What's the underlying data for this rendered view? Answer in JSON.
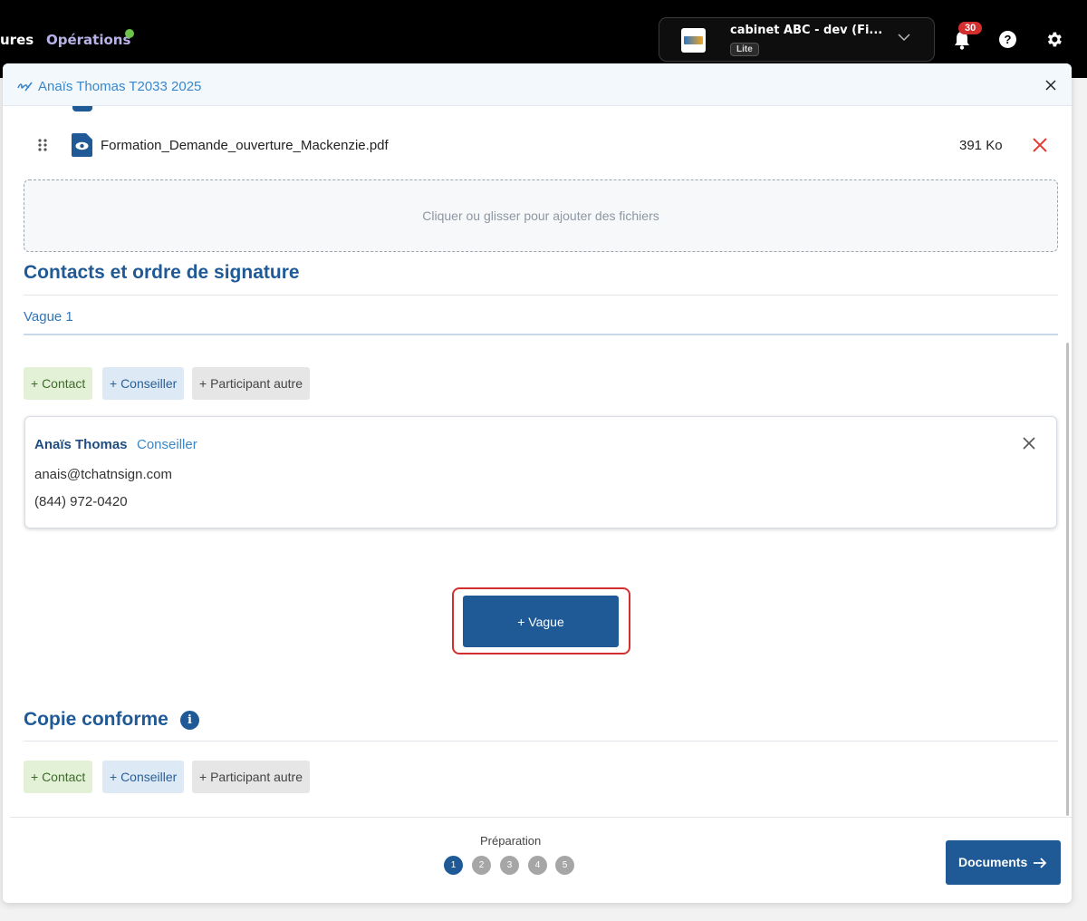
{
  "topbar": {
    "nav_partial": "ures",
    "nav_operations": "Opérations",
    "account_name": "cabinet ABC - dev (Fi...",
    "account_plan": "Lite",
    "notification_count": "30",
    "help_label": "?"
  },
  "modal": {
    "title": "Anaïs Thomas T2033 2025",
    "file": {
      "name": "Formation_Demande_ouverture_Mackenzie.pdf",
      "size": "391 Ko"
    },
    "dropzone_text": "Cliquer ou glisser pour ajouter des fichiers",
    "contacts_heading": "Contacts et ordre de signature",
    "wave_label": "Vague 1",
    "chips": {
      "contact": "+ Contact",
      "advisor": "+ Conseiller",
      "other": "+ Participant autre"
    },
    "participant": {
      "name": "Anaïs Thomas",
      "role": "Conseiller",
      "email": "anais@tchatnsign.com",
      "phone": "(844) 972-0420"
    },
    "add_wave_button": "+ Vague",
    "copy_heading": "Copie conforme",
    "info_label": "i"
  },
  "footer": {
    "step_label": "Préparation",
    "steps": [
      "1",
      "2",
      "3",
      "4",
      "5"
    ],
    "active_step": 1,
    "next_button": "Documents"
  },
  "colors": {
    "primary": "#1f5a96",
    "highlight": "#d32f2f",
    "link": "#3a87c8"
  }
}
